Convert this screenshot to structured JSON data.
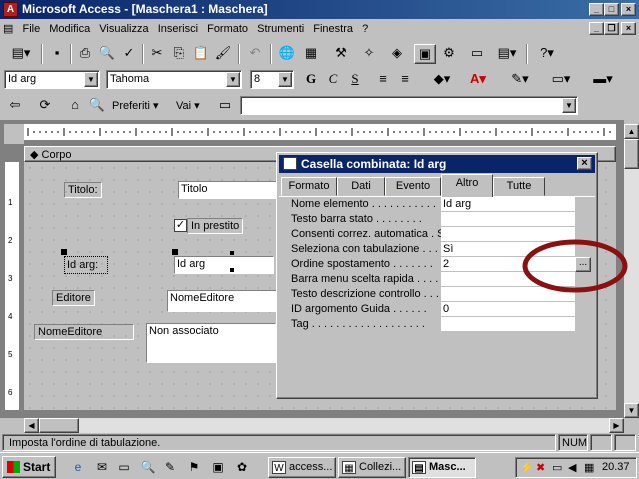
{
  "window": {
    "title": "Microsoft Access - [Maschera1 : Maschera]",
    "app_icon": "access-icon"
  },
  "menu": [
    "File",
    "Modifica",
    "Visualizza",
    "Inserisci",
    "Formato",
    "Strumenti",
    "Finestra",
    "?"
  ],
  "format_toolbar": {
    "object_combo": "Id arg",
    "font_combo": "Tahoma",
    "size_combo": "8",
    "bold": "G",
    "italic": "C",
    "underline": "S"
  },
  "web_toolbar": {
    "favorites": "Preferiti",
    "go": "Vai",
    "address": ""
  },
  "section": {
    "header": "Corpo"
  },
  "form": {
    "label_titolo": "Titolo:",
    "field_titolo": "Titolo",
    "checkbox_in_prestito": "In prestito",
    "checkbox_checked": true,
    "label_id_arg": "Id arg:",
    "field_id_arg": "Id arg",
    "label_editore": "Editore",
    "field_nome_editore": "NomeEditore",
    "label_nome_editore": "NomeEditore",
    "field_non_associato": "Non associato"
  },
  "vruler_labels": [
    "1",
    "2",
    "3",
    "4",
    "5",
    "6"
  ],
  "dialog": {
    "title": "Casella combinata: Id arg",
    "tabs": [
      "Formato",
      "Dati",
      "Evento",
      "Altro",
      "Tutte"
    ],
    "active_tab": "Altro",
    "properties": [
      {
        "name": "Nome elemento . . . . . . . . . . .",
        "value": "Id arg"
      },
      {
        "name": "Testo barra stato . . . . . . . .",
        "value": ""
      },
      {
        "name": "Consenti correz. automatica . Sì",
        "value": ""
      },
      {
        "name": "Seleziona con tabulazione . . . .",
        "value": "Sì"
      },
      {
        "name": "Ordine spostamento . . . . . . .",
        "value": "2"
      },
      {
        "name": "Barra menu scelta rapida . . . .",
        "value": ""
      },
      {
        "name": "Testo descrizione controllo . . .",
        "value": ""
      },
      {
        "name": "ID argomento Guida . . . . . .",
        "value": "0"
      },
      {
        "name": "Tag . . . . . . . . . . . . . . . . . . .",
        "value": ""
      }
    ],
    "builder_button": "..."
  },
  "status": {
    "text": "Imposta l'ordine di tabulazione.",
    "num": "NUM"
  },
  "taskbar": {
    "start": "Start",
    "tasks": [
      "access...",
      "Collezi...",
      "Masc..."
    ],
    "clock": "20.37"
  },
  "colors": {
    "titlebar": "#0a246a",
    "annotation_ellipse": "#8b1010"
  }
}
